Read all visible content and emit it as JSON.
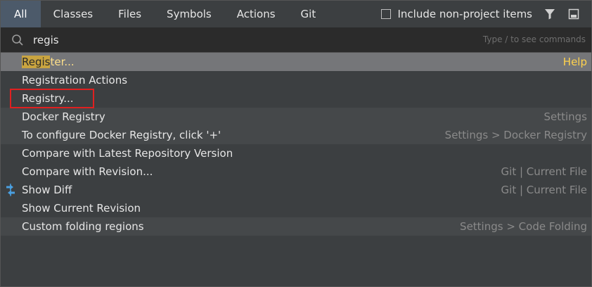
{
  "tabs": [
    {
      "label": "All",
      "active": true
    },
    {
      "label": "Classes",
      "active": false
    },
    {
      "label": "Files",
      "active": false
    },
    {
      "label": "Symbols",
      "active": false
    },
    {
      "label": "Actions",
      "active": false
    },
    {
      "label": "Git",
      "active": false
    }
  ],
  "toolbar": {
    "include_non_project_label": "Include non-project items",
    "include_non_project_checked": false,
    "filter_icon": "filter-icon",
    "preview_icon": "preview-panel-icon"
  },
  "search": {
    "value": "regis",
    "hint": "Type / to see commands",
    "icon": "search-icon"
  },
  "results": [
    {
      "label_match": "Regis",
      "label_rest": "ter...",
      "hint": "Help",
      "selected": true
    },
    {
      "label": "Registration Actions",
      "hint": ""
    },
    {
      "label": "Registry...",
      "hint": "",
      "outlined": true
    },
    {
      "label": "Docker Registry",
      "hint": "Settings"
    },
    {
      "label": "To configure Docker Registry, click '+'",
      "hint": "Settings > Docker Registry"
    },
    {
      "label": "Compare with Latest Repository Version",
      "hint": ""
    },
    {
      "label": "Compare with Revision...",
      "hint": "Git | Current File"
    },
    {
      "label": "Show Diff",
      "hint": "Git | Current File",
      "icon": "diff-arrows-icon"
    },
    {
      "label": "Show Current Revision",
      "hint": ""
    },
    {
      "label": "Custom folding regions",
      "hint": "Settings > Code Folding"
    }
  ],
  "colors": {
    "background": "#3c3f41",
    "active_tab": "#4c5a6a",
    "selected_row": "#757679",
    "match_highlight": "#c9a440",
    "outline": "#e02020",
    "diff_icon": "#4a9fe0"
  }
}
